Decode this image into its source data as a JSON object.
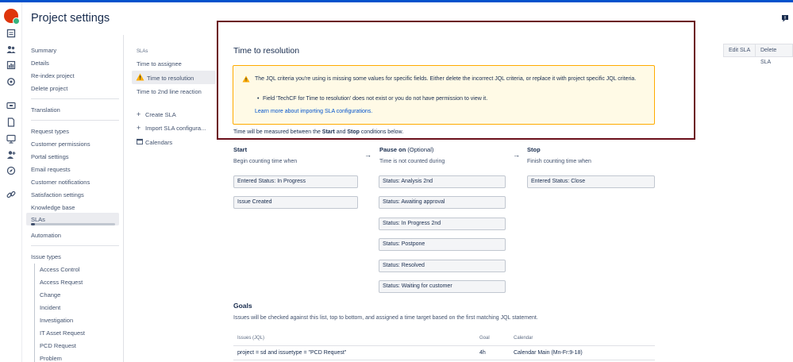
{
  "header": {
    "title": "Project settings"
  },
  "sidebar": {
    "items": [
      {
        "label": "Summary"
      },
      {
        "label": "Details"
      },
      {
        "label": "Re-index project"
      },
      {
        "label": "Delete project"
      },
      {
        "label": "Translation"
      },
      {
        "label": "Request types"
      },
      {
        "label": "Customer permissions"
      },
      {
        "label": "Portal settings"
      },
      {
        "label": "Email requests"
      },
      {
        "label": "Customer notifications"
      },
      {
        "label": "Satisfaction settings"
      },
      {
        "label": "Knowledge base"
      },
      {
        "label": "SLAs"
      },
      {
        "label": "Automation"
      },
      {
        "label": "Issue types"
      }
    ],
    "issue_types": [
      {
        "label": "Access Control"
      },
      {
        "label": "Access Request"
      },
      {
        "label": "Change"
      },
      {
        "label": "Incident"
      },
      {
        "label": "Investigation"
      },
      {
        "label": "IT Asset Request"
      },
      {
        "label": "PCD Request"
      },
      {
        "label": "Problem"
      }
    ]
  },
  "sla_list": {
    "heading": "SLAs",
    "items": [
      {
        "label": "Time to assignee"
      },
      {
        "label": "Time to resolution"
      },
      {
        "label": "Time to 2nd line reaction"
      }
    ],
    "actions": [
      {
        "icon": "+",
        "label": "Create SLA"
      },
      {
        "icon": "+",
        "label": "Import SLA configura..."
      },
      {
        "icon": "calendar-icon",
        "label": "Calendars"
      }
    ]
  },
  "main": {
    "title": "Time to resolution",
    "edit_label": "Edit SLA",
    "delete_label": "Delete SLA",
    "warning": {
      "message": "The JQL criteria you're using is missing some values for specific fields. Either delete the incorrect JQL criteria, or replace it with project specific JQL criteria.",
      "bullet": "Field 'TechCF for Time to resolution' does not exist or you do not have permission to view it.",
      "link": "Learn more about importing SLA configurations."
    },
    "measure": {
      "prefix": "Time will be measured between the ",
      "start": "Start",
      "and": " and ",
      "stop": "Stop",
      "suffix": " conditions below."
    },
    "start": {
      "title": "Start",
      "desc": "Begin counting time when",
      "conditions": [
        "Entered Status: In Progress",
        "Issue Created"
      ]
    },
    "pause": {
      "title": "Pause on",
      "optional": " (Optional)",
      "desc": "Time is not counted during",
      "conditions": [
        "Status: Analysis 2nd",
        "Status: Awaiting approval",
        "Status: In Progress 2nd",
        "Status: Postpone",
        "Status: Resolved",
        "Status: Waiting for customer"
      ]
    },
    "stop": {
      "title": "Stop",
      "desc": "Finish counting time when",
      "conditions": [
        "Entered Status: Close"
      ]
    },
    "arrow": "→",
    "goals": {
      "title": "Goals",
      "desc": "Issues will be checked against this list, top to bottom, and assigned a time target based on the first matching JQL statement.",
      "headers": {
        "jql": "Issues (JQL)",
        "goal": "Goal",
        "calendar": "Calendar"
      },
      "rows": [
        {
          "jql": "project = sd and issuetype = \"PCD Request\"",
          "goal": "4h",
          "calendar": "Calendar Main (Mn-Fr:9-18)"
        }
      ]
    }
  },
  "colors": {
    "accent": "#0052cc",
    "warning_border": "#ffab00",
    "warning_bg": "#fffae6",
    "highlight_frame": "#6b0f1a",
    "logo": "#de350b"
  }
}
